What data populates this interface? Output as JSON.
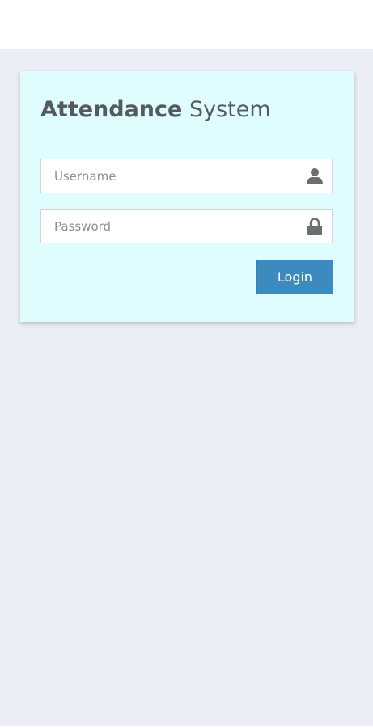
{
  "login": {
    "title_bold": "Attendance",
    "title_light": "System",
    "username_placeholder": "Username",
    "username_value": "",
    "password_placeholder": "Password",
    "password_value": "",
    "login_label": "Login"
  },
  "icons": {
    "username": "user-icon",
    "password": "lock-icon"
  },
  "colors": {
    "page_background": "#eceef5",
    "card_background": "#dffdfe",
    "button_background": "#3d8abf",
    "icon_color": "#6b6f72",
    "title_color": "#555a5e"
  }
}
